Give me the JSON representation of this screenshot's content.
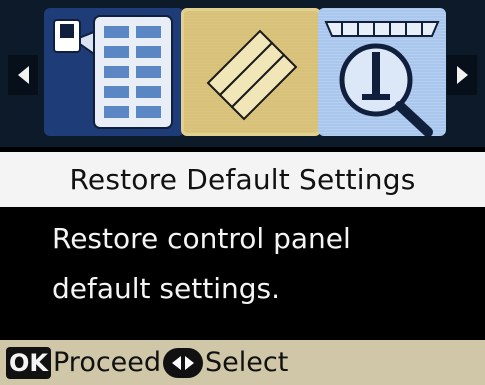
{
  "carousel": {
    "items": [
      {
        "icon": "photo-sheet-icon"
      },
      {
        "icon": "cleaning-brush-icon",
        "selected": true
      },
      {
        "icon": "nozzle-check-magnifier-icon"
      }
    ]
  },
  "title": "Restore Default Settings",
  "message": {
    "line1": "Restore control panel",
    "line2": "default settings."
  },
  "footer": {
    "ok_key": "OK",
    "ok_action": "Proceed",
    "select_action": "Select"
  },
  "colors": {
    "selected_tile": "#d8c178",
    "footer_bg": "#cfc7a8"
  }
}
